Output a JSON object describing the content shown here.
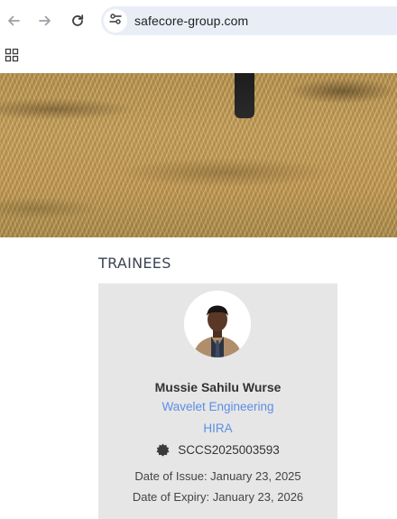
{
  "browser": {
    "url": "safecore-group.com",
    "icons": {
      "back": "back-arrow-icon",
      "forward": "forward-arrow-icon",
      "reload": "reload-icon",
      "site_info": "tune-icon",
      "apps": "apps-grid-icon"
    }
  },
  "page": {
    "section_title": "TRAINEES",
    "trainee": {
      "name": "Mussie Sahilu Wurse",
      "company": "Wavelet Engineering",
      "course": "HIRA",
      "certificate_number": "SCCS2025003593",
      "issue_date": "Date of Issue: January 23, 2025",
      "expiry_date": "Date of Expiry: January 23, 2026"
    },
    "colors": {
      "link": "#5b8ee6",
      "card_bg": "#e6e6e6",
      "omnibox_bg": "#e9eef6"
    }
  }
}
